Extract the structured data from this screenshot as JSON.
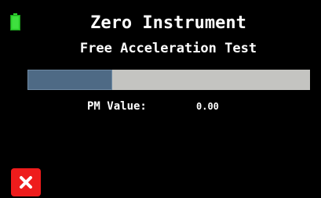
{
  "header": {
    "title": "Zero Instrument",
    "subtitle": "Free Acceleration Test"
  },
  "status": {
    "battery_icon": "battery-icon",
    "battery_color": "#2fd32f"
  },
  "progress": {
    "fraction": 0.3,
    "fill_color": "#4e6a85",
    "track_color": "#c4c4c1"
  },
  "reading": {
    "label": "PM Value:",
    "value": "0.00"
  },
  "actions": {
    "close_icon": "close-icon",
    "close_color": "#ee1c1c"
  }
}
